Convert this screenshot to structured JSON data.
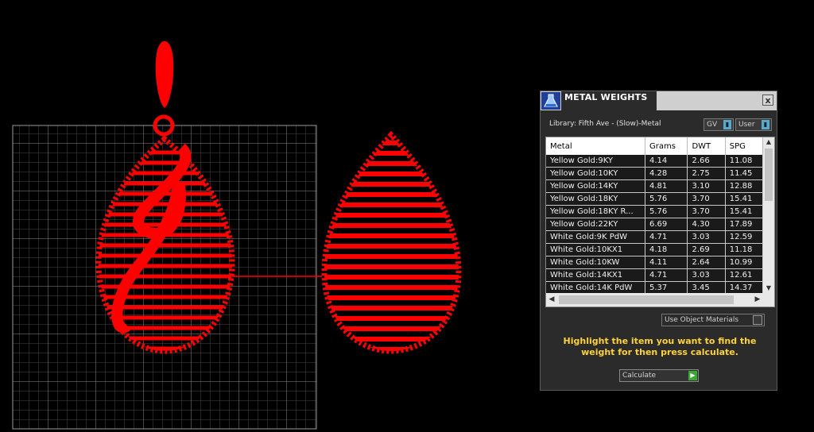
{
  "panel": {
    "title": "METAL WEIGHTS",
    "close": "x",
    "library_label": "Library: Fifth Ave - (Slow)-Metal",
    "dropdown_gv": "GV",
    "dropdown_user": "User",
    "columns": [
      "Metal",
      "Grams",
      "DWT",
      "SPG"
    ],
    "rows": [
      [
        "Yellow Gold:9KY",
        "4.14",
        "2.66",
        "11.08"
      ],
      [
        "Yellow Gold:10KY",
        "4.28",
        "2.75",
        "11.45"
      ],
      [
        "Yellow Gold:14KY",
        "4.81",
        "3.10",
        "12.88"
      ],
      [
        "Yellow Gold:18KY",
        "5.76",
        "3.70",
        "15.41"
      ],
      [
        "Yellow Gold:18KY R...",
        "5.76",
        "3.70",
        "15.41"
      ],
      [
        "Yellow Gold:22KY",
        "6.69",
        "4.30",
        "17.89"
      ],
      [
        "White Gold:9K PdW",
        "4.71",
        "3.03",
        "12.59"
      ],
      [
        "White Gold:10KX1",
        "4.18",
        "2.69",
        "11.18"
      ],
      [
        "White Gold:10KW",
        "4.11",
        "2.64",
        "10.99"
      ],
      [
        "White Gold:14KX1",
        "4.71",
        "3.03",
        "12.61"
      ],
      [
        "White Gold:14K PdW",
        "5.37",
        "3.45",
        "14.37"
      ]
    ],
    "use_object_materials": "Use Object Materials",
    "hint": "Highlight the item you want to find the weight for then press calculate.",
    "calculate": "Calculate"
  },
  "colors": {
    "model": "#ff0000",
    "grid": "#6a6a6a",
    "hint_text": "#ffd23a",
    "panel_bg": "#2b2b2b"
  },
  "icons": {
    "panel_icon": "flask-icon",
    "close": "close-icon",
    "dropdown_arrow": "dropdown-arrow-icon",
    "go_arrow": "play-arrow-icon"
  }
}
